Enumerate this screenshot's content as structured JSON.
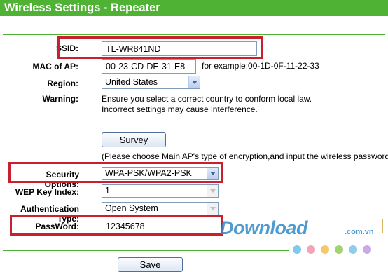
{
  "header": {
    "title": "Wireless Settings - Repeater"
  },
  "form": {
    "ssid": {
      "label": "SSID:",
      "value": "TL-WR841ND"
    },
    "mac": {
      "label": "MAC of AP:",
      "value": "00-23-CD-DE-31-E8",
      "example": "for example:00-1D-0F-11-22-33"
    },
    "region": {
      "label": "Region:",
      "value": "United States"
    },
    "warning": {
      "label": "Warning:",
      "line1": "Ensure you select a correct country to conform local law.",
      "line2": "Incorrect settings may cause interference."
    },
    "survey": {
      "button": "Survey",
      "note": "(Please choose Main AP's type of encryption,and input the wireless password)"
    },
    "security": {
      "label": "Security Options:",
      "value": "WPA-PSK/WPA2-PSK"
    },
    "wep_key_index": {
      "label": "WEP Key Index:",
      "value": "1"
    },
    "auth_type": {
      "label": "Authentication Type:",
      "value": "Open System"
    },
    "password": {
      "label": "PassWord:",
      "value": "12345678"
    }
  },
  "footer": {
    "save_label": "Save"
  },
  "watermark": {
    "text": "Download",
    "suffix": ".com.vn"
  },
  "colors": {
    "brand_green": "#4fb234",
    "highlight_red": "#c8202f",
    "watermark_blue": "#2f8ac9"
  },
  "icons": [
    "chevron-down-icon"
  ]
}
